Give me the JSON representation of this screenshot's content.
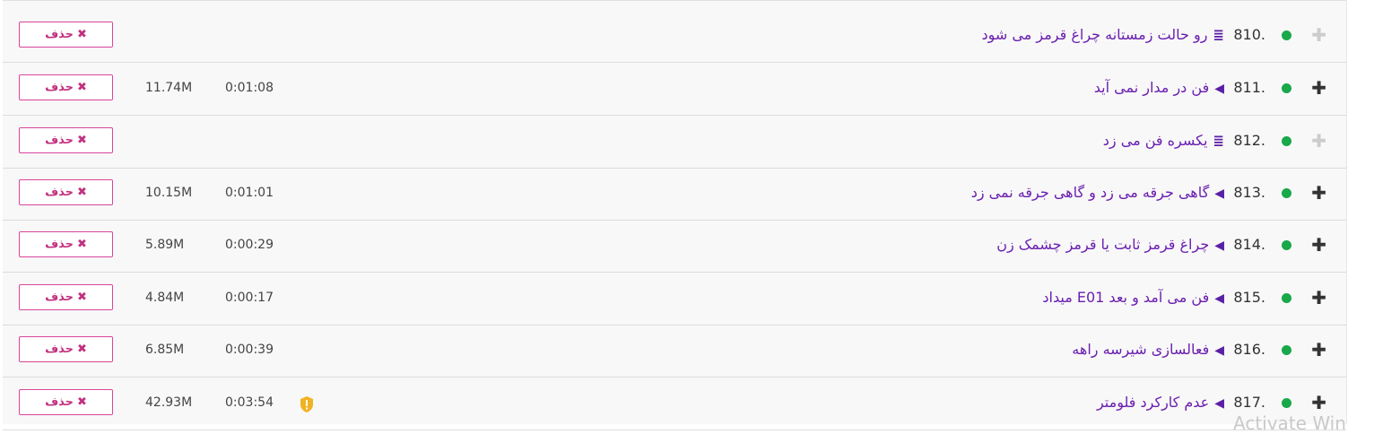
{
  "delete_label": "حذف",
  "watermark": "Activate Win",
  "rows": [
    {
      "number": "810.",
      "type_icon": "list-icon",
      "title": "رو حالت زمستانه چراغ قرمز می شود",
      "duration": "",
      "size": "",
      "warning": false,
      "plus_active": false
    },
    {
      "number": "811.",
      "type_icon": "play-icon",
      "title": "فن در مدار نمی آید",
      "duration": "0:01:08",
      "size": "11.74M",
      "warning": false,
      "plus_active": true
    },
    {
      "number": "812.",
      "type_icon": "list-icon",
      "title": "یکسره فن می زد",
      "duration": "",
      "size": "",
      "warning": false,
      "plus_active": false
    },
    {
      "number": "813.",
      "type_icon": "play-icon",
      "title": "گاهی جرقه می زد و گاهی جرقه نمی زد",
      "duration": "0:01:01",
      "size": "10.15M",
      "warning": false,
      "plus_active": true
    },
    {
      "number": "814.",
      "type_icon": "play-icon",
      "title": "چراغ قرمز ثابت یا قرمز چشمک زن",
      "duration": "0:00:29",
      "size": "5.89M",
      "warning": false,
      "plus_active": true
    },
    {
      "number": "815.",
      "type_icon": "play-icon",
      "title": "فن می آمد و بعد E01 میداد",
      "duration": "0:00:17",
      "size": "4.84M",
      "warning": false,
      "plus_active": true
    },
    {
      "number": "816.",
      "type_icon": "play-icon",
      "title": "فعالسازی شیرسه راهه",
      "duration": "0:00:39",
      "size": "6.85M",
      "warning": false,
      "plus_active": true
    },
    {
      "number": "817.",
      "type_icon": "play-icon",
      "title": "عدم کارکرد فلومتر",
      "duration": "0:03:54",
      "size": "42.93M",
      "warning": true,
      "plus_active": true
    }
  ]
}
